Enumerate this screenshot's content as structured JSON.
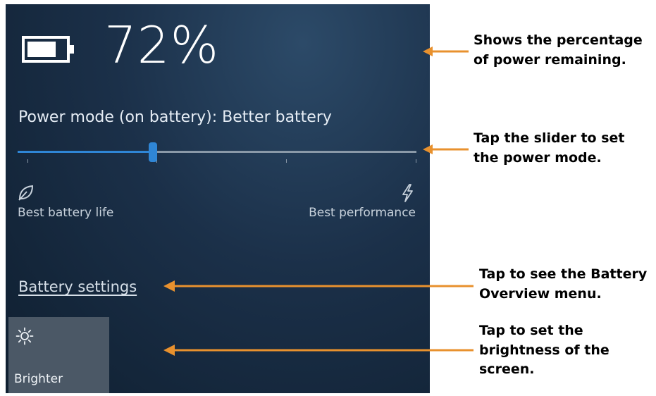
{
  "battery": {
    "percent_text": "72%",
    "level": 0.72,
    "icon": "battery-icon"
  },
  "power_mode": {
    "label": "Power mode (on battery): Better battery",
    "slider_value": 0.34,
    "min_label": "Best battery life",
    "max_label": "Best performance",
    "min_icon": "leaf-icon",
    "max_icon": "lightning-bolt-icon"
  },
  "battery_settings_link": "Battery settings",
  "brightness": {
    "label": "Brighter",
    "icon": "sun-icon"
  },
  "annotations": [
    {
      "line1": "Shows the percentage",
      "line2": "of power remaining.",
      "line3": ""
    },
    {
      "line1": "Tap the slider to set",
      "line2": "the power mode.",
      "line3": ""
    },
    {
      "line1": "Tap to see the Battery",
      "line2": "Overview menu.",
      "line3": ""
    },
    {
      "line1": "Tap to set the",
      "line2": "brightness of the",
      "line3": "screen."
    }
  ],
  "colors": {
    "accent": "#2f86d6",
    "arrow": "#e8912e",
    "panel": "#1b3049"
  }
}
